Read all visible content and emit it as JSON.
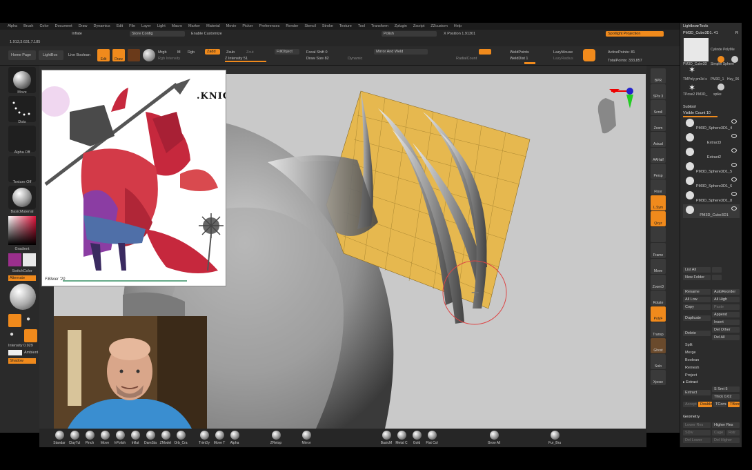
{
  "menu": [
    "Alpha",
    "Brush",
    "Color",
    "Document",
    "Draw",
    "Dynamics",
    "Edit",
    "File",
    "Layer",
    "Light",
    "Macro",
    "Marker",
    "Material",
    "Movie",
    "Picker",
    "Preferences",
    "Render",
    "Stencil",
    "Stroke",
    "Texture",
    "Tool",
    "Transform",
    "Zplugin",
    "Zscript",
    "ZZcustom",
    "Help"
  ],
  "toolbar": {
    "inflate": "Inflate",
    "store_config": "Store Config",
    "enable_customize": "Enable Customize",
    "polish": "Polish",
    "x_position": "X Position 1.91301",
    "spotlight_projection": "Spotlight Projection",
    "coords": "1.913,3.631,7.185",
    "home_page": "Home Page",
    "lightbox": "LightBox",
    "live_boolean": "Live Boolean",
    "edit": "Edit",
    "draw": "Draw",
    "mrgb": "Mrgb",
    "m": "M",
    "rgb": "Rgb",
    "zadd": "Zadd",
    "zsub": "Zsub",
    "zcut": "Zcut",
    "rgb_intensity": "Rgb Intensity",
    "z_intensity": "Z Intensity 51",
    "fill_object": "FillObject",
    "focal_shift": "Focal Shift 0",
    "draw_size": "Draw Size 82",
    "dynamic": "Dynamic",
    "mirror_and_weld": "Mirror And Weld",
    "radial_count": "RadialCount",
    "weld_points": "WeldPoints",
    "weld_dist": "WeldDist 1",
    "lazy_mouse": "LazyMouse",
    "lazy_radius": "LazyRadius",
    "active_points": "ActivePoints: 81",
    "total_points": "TotalPoints: 333,857"
  },
  "left_tray": {
    "move": "Move",
    "dots": "Dots",
    "alpha_off": "Alpha Off",
    "texture_off": "Texture Off",
    "basic_material": "BasicMaterial",
    "gradient": "Gradient",
    "switch_color": "SwitchColor",
    "alternate": "Alternate",
    "intensity": "Intensity 0.929",
    "ambient": "Ambient 4",
    "shadow": "Shadow"
  },
  "reference": {
    "title": ".KNIG",
    "signature": "F.Bleier '20"
  },
  "right_shelf": [
    "BPR",
    "SPix 3",
    "Scroll",
    "Zoom",
    "Actual",
    "AAHalf",
    "Persp",
    "Floor",
    "L.Sym",
    "Qxyz",
    "",
    "Frame",
    "Move",
    "ZoomD",
    "Rotate",
    "PolyF",
    "Transp",
    "Ghost",
    "Solo",
    "Xpose"
  ],
  "right_tray": {
    "lightbox_tools": "Lightbox▸Tools",
    "current_tool": "PM3D_Cube3D1. 41",
    "r_label": "R",
    "tools": [
      "PM3D_Cube3D",
      "Cylinde PolyMe",
      "TMPoly pm3d s",
      "PM3D_1",
      "Huy_06",
      "TPose2 PM3D_",
      "spike",
      "Simplel Sphere"
    ],
    "subtool": "Subtool",
    "visible_count": "Visible Count 10",
    "subtools": [
      "PM3D_Sphere3D1_4",
      "Extract3",
      "Extract2",
      "PM3D_Sphere3D1_5",
      "PM3D_Sphere3D1_6",
      "PM3D_Sphere3D1_8",
      "PM3D_Cube3D1"
    ],
    "list_all": "List All",
    "new_folder": "New Folder",
    "rename": "Rename",
    "auto_reorder": "AutoReorder",
    "all_low": "All Low",
    "all_high": "All High",
    "copy": "Copy",
    "paste": "Paste",
    "duplicate": "Duplicate",
    "append": "Append",
    "insert": "Insert",
    "delete": "Delete",
    "del_other": "Del Other",
    "del_all": "Del All",
    "split": "Split",
    "merge": "Merge",
    "boolean": "Boolean",
    "remesh": "Remesh",
    "project": "Project",
    "extract_hdr": "▸ Extract",
    "extract": "Extract",
    "s_smt": "S Smt 5",
    "thick": "Thick 0.02",
    "accept": "Accept",
    "double": "Double",
    "tcorne": "TCorne",
    "tborde": "TBorde",
    "geometry": "Geometry",
    "lower_res": "Lower Res",
    "higher_res": "Higher Res",
    "sdiv": "SDiv",
    "cage": "Cage",
    "rstr": "Rstr",
    "del_lower": "Del Lower",
    "del_higher": "Del Higher"
  },
  "bottom_shelf": [
    "Standar",
    "ClayTul",
    "Pinch",
    "Move",
    "hPolish",
    "Inflat",
    "DamSta",
    "ZModel",
    "Orb_Cra",
    "TrimDy",
    "Move T",
    "Alpha",
    "ZRetop",
    "Mirror",
    "BasicM",
    "Metal C",
    "Gold",
    "Flat Col",
    "Grow All",
    "Fur_Bru"
  ],
  "colors": {
    "accent": "#f08a1c",
    "patch": "#e6b84f",
    "secondary_color": "#9b2f8c"
  }
}
